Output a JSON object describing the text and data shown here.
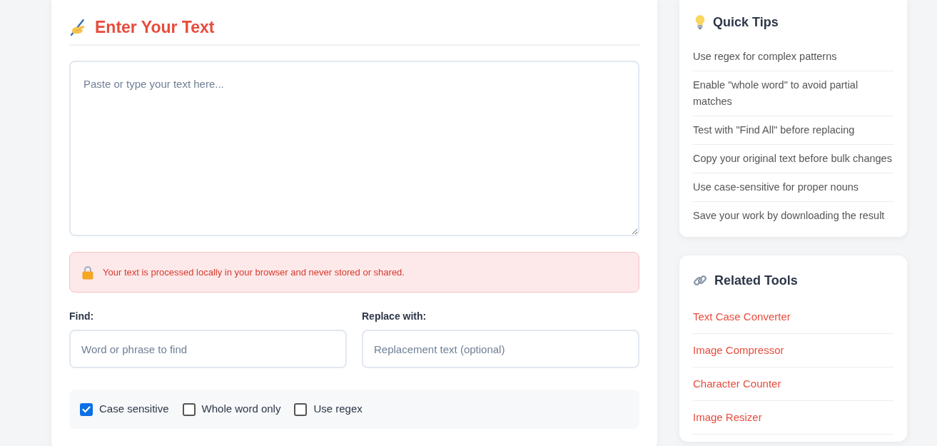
{
  "editor": {
    "title": "Enter Your Text",
    "textarea": {
      "placeholder": "Paste or type your text here..."
    },
    "privacy_notice": "Your text is processed locally in your browser and never stored or shared.",
    "find": {
      "label": "Find:",
      "placeholder": "Word or phrase to find"
    },
    "replace": {
      "label": "Replace with:",
      "placeholder": "Replacement text (optional)"
    },
    "options": [
      {
        "label": "Case sensitive",
        "checked": true
      },
      {
        "label": "Whole word only",
        "checked": false
      },
      {
        "label": "Use regex",
        "checked": false
      }
    ]
  },
  "quick_tips": {
    "title": "Quick Tips",
    "items": [
      "Use regex for complex patterns",
      "Enable \"whole word\" to avoid partial matches",
      "Test with \"Find All\" before replacing",
      "Copy your original text before bulk changes",
      "Use case-sensitive for proper nouns",
      "Save your work by downloading the result"
    ]
  },
  "related_tools": {
    "title": "Related Tools",
    "links": [
      "Text Case Converter",
      "Image Compressor",
      "Character Counter",
      "Image Resizer"
    ]
  }
}
